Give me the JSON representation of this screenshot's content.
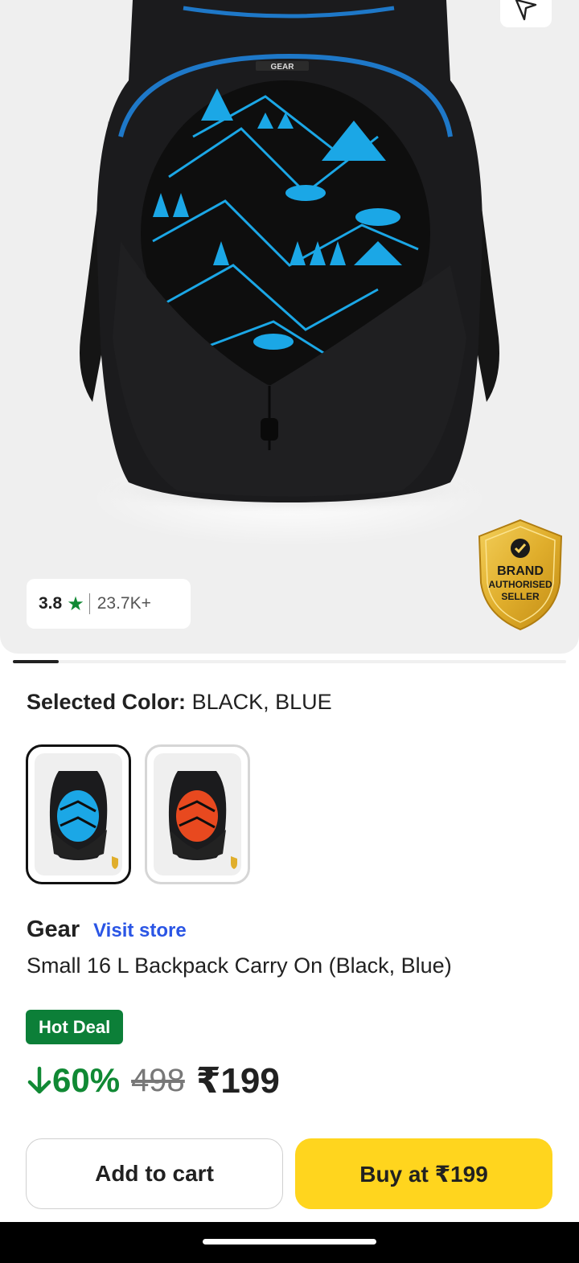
{
  "hero": {
    "rating": "3.8",
    "rating_star": "★",
    "rating_count": "23.7K+",
    "badge": {
      "line1": "BRAND",
      "line2": "AUTHORISED",
      "line3": "SELLER"
    },
    "bag_logo": "GEAR",
    "carousel": {
      "active_index": 0
    }
  },
  "color_selector": {
    "label": "Selected Color:",
    "value": "BLACK, BLUE",
    "swatches": [
      {
        "name": "black-blue",
        "selected": true,
        "accent": "#1ba7e6"
      },
      {
        "name": "black-orange",
        "selected": false,
        "accent": "#e8491f"
      }
    ]
  },
  "product": {
    "brand": "Gear",
    "visit_store": "Visit store",
    "title": "Small 16 L Backpack Carry On (Black, Blue)"
  },
  "pricing": {
    "deal_badge": "Hot Deal",
    "discount": "60%",
    "mrp": "498",
    "price": "₹199"
  },
  "actions": {
    "add_to_cart": "Add to cart",
    "buy_now": "Buy at ₹199"
  },
  "colors": {
    "accent_green": "#108934",
    "deal_green": "#0c7f38",
    "buy_yellow": "#ffd51e",
    "link_blue": "#2a55e5",
    "bag_blue": "#1ba7e6"
  },
  "icons": [
    "share-icon",
    "star-icon",
    "check-icon",
    "discount-arrow-icon"
  ]
}
